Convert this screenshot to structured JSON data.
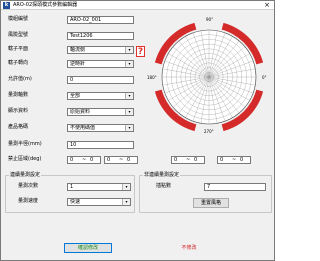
{
  "window": {
    "icon_letter": "k",
    "title": "ARO-02探頭模式參數編輯器",
    "close_glyph": "×"
  },
  "form": {
    "labels": {
      "model_code": "模組編號",
      "probe_model": "風險型號",
      "probe_plane": "轄子平面",
      "probe_direction": "轄子轉向",
      "allowed_value": "允許值(m)",
      "measure_method": "量測軸數",
      "display_data": "顯示資料",
      "product_format": "產品格碼",
      "scan_radius": "量測半徑(mm)",
      "forbidden_zone": "禁止區域(deg)"
    },
    "values": {
      "model_code": "ARO-02_001",
      "probe_model": "Test1206",
      "probe_plane": "軸流側",
      "probe_direction": "逆時針",
      "allowed_value": "0",
      "measure_method": "全部",
      "display_data": "原始資料",
      "product_format": "不使用碼值",
      "scan_radius": "10"
    },
    "dropdown_arrow": "▾",
    "help_glyph": "?",
    "ranges": [
      {
        "from": "0",
        "sep": "~",
        "to": "0"
      },
      {
        "from": "0",
        "sep": "~",
        "to": "0"
      },
      {
        "from": "0",
        "sep": "~",
        "to": "0"
      },
      {
        "from": "0",
        "sep": "~",
        "to": "0"
      }
    ]
  },
  "polar_chart": {
    "angle_labels": {
      "top": "90°",
      "right": "0°",
      "bottom": "270°",
      "left": "180°"
    },
    "ring_count": 10,
    "spoke_count": 36,
    "highlight_color": "#d42a2a"
  },
  "group_fast": {
    "title": "連續量測設定",
    "count_label": "量測次數",
    "count_value": "1",
    "speed_label": "量測速度",
    "speed_value": "快速"
  },
  "group_step": {
    "title": "非連續量測設定",
    "points_label": "插點數",
    "points_value": "7",
    "reset_button": "重置風格"
  },
  "buttons": {
    "confirm": "確認修改",
    "cancel": "不修改"
  }
}
